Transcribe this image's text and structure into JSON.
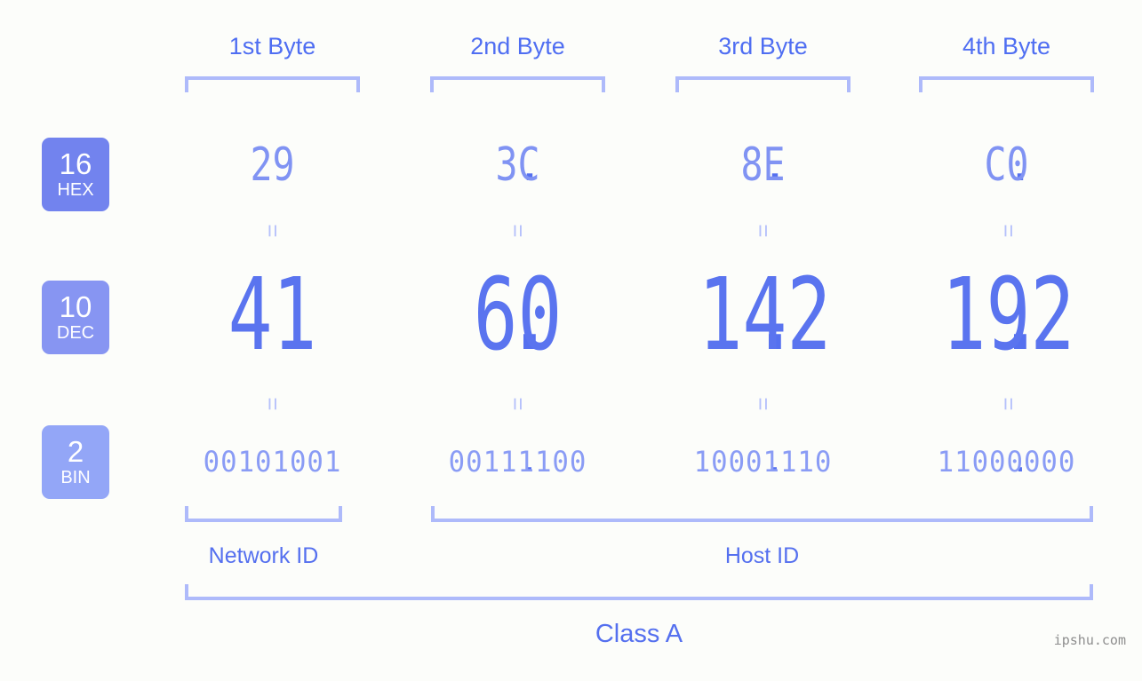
{
  "background_color": "#fcfdfa",
  "accent_color": "#5570ef",
  "byte_headers": [
    {
      "label": "1st Byte"
    },
    {
      "label": "2nd Byte"
    },
    {
      "label": "3rd Byte"
    },
    {
      "label": "4th Byte"
    }
  ],
  "bases": [
    {
      "number": "16",
      "name": "HEX",
      "color": "#7283ee"
    },
    {
      "number": "10",
      "name": "DEC",
      "color": "#8795f2"
    },
    {
      "number": "2",
      "name": "BIN",
      "color": "#93a6f7"
    }
  ],
  "separator": ".",
  "equals_mark": "=",
  "rows": {
    "hex": {
      "base_label": "HEX",
      "base_number": "16",
      "values": [
        "29",
        "3C",
        "8E",
        "C0"
      ]
    },
    "dec": {
      "base_label": "DEC",
      "base_number": "10",
      "values": [
        "41",
        "60",
        "142",
        "192"
      ]
    },
    "bin": {
      "base_label": "BIN",
      "base_number": "2",
      "values": [
        "00101001",
        "00111100",
        "10001110",
        "11000000"
      ]
    }
  },
  "segments": {
    "network_id": "Network ID",
    "host_id": "Host ID",
    "class": "Class A"
  },
  "watermark": "ipshu.com"
}
